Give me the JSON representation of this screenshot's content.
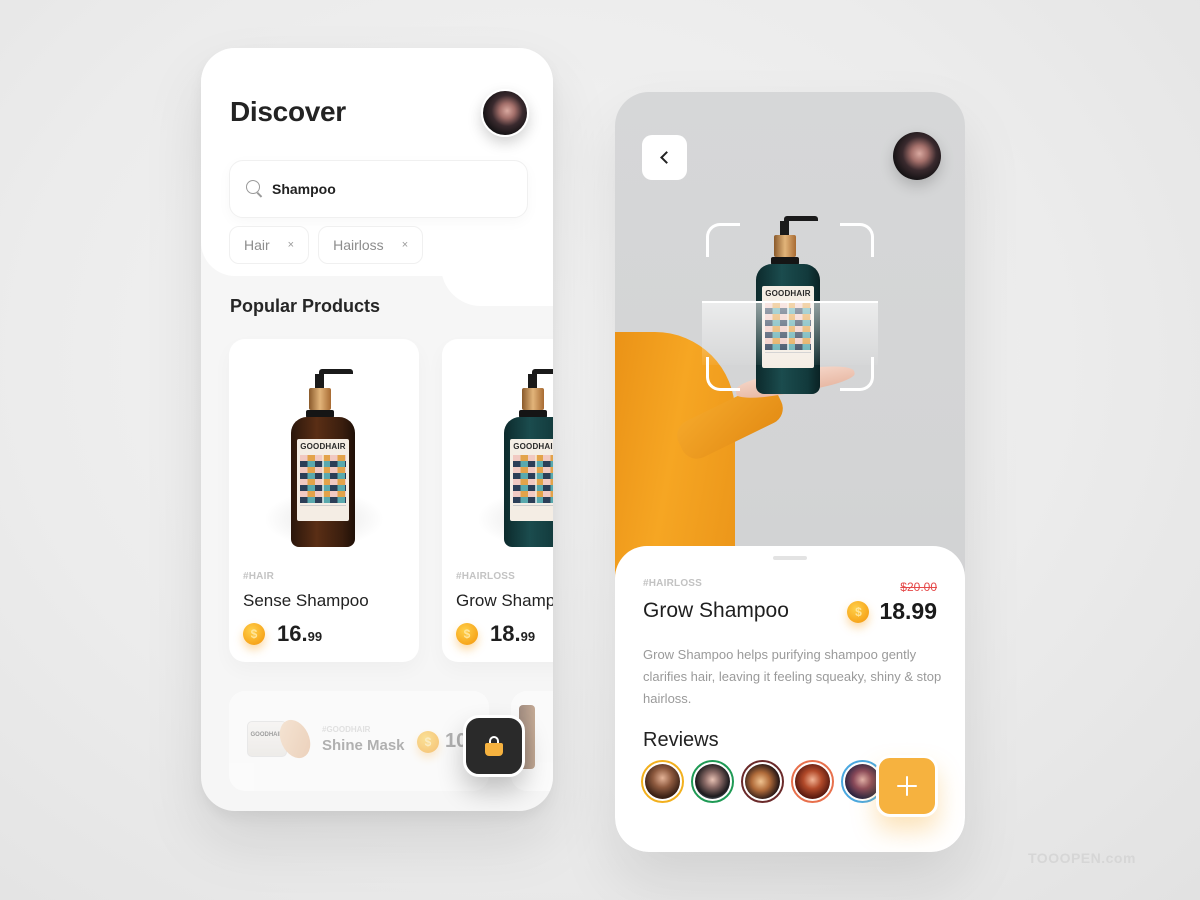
{
  "discover": {
    "title": "Discover",
    "search": {
      "value": "Shampoo",
      "placeholder": "Search"
    },
    "chips": [
      {
        "label": "Hair",
        "remove": "×"
      },
      {
        "label": "Hairloss",
        "remove": "×"
      }
    ],
    "section_title": "Popular Products",
    "products": [
      {
        "tag": "#HAIR",
        "name": "Sense Shampoo",
        "price_main": "16.",
        "price_cents": "99",
        "brand": "GOODHAIR",
        "bottle_color": "brown"
      },
      {
        "tag": "#HAIRLOSS",
        "name": "Grow Shampoo",
        "price_main": "18.",
        "price_cents": "99",
        "brand": "GOODHAIR",
        "bottle_color": "teal"
      }
    ],
    "secondary_product": {
      "tag": "#GOODHAIR",
      "name": "Shine Mask",
      "price_partial": "10",
      "brand": "GOODHAIR"
    },
    "cart_button": {
      "icon": "shopping-bag-icon"
    }
  },
  "detail": {
    "back_icon": "chevron-left-icon",
    "bottle_brand": "GOODHAIR",
    "tag": "#HAIRLOSS",
    "name": "Grow Shampoo",
    "old_price": "$20.00",
    "price": "18.99",
    "coin_symbol": "$",
    "description": "Grow Shampoo helps purifying shampoo gently clarifies hair, leaving it feeling squeaky, shiny & stop hairloss.",
    "reviews_title": "Reviews",
    "reviewers": [
      {
        "ring_color": "#f2b01e"
      },
      {
        "ring_color": "#1f9a55"
      },
      {
        "ring_color": "#6b2a2a"
      },
      {
        "ring_color": "#e8704c"
      },
      {
        "ring_color": "#4aa8e0"
      }
    ],
    "add_button": {
      "icon": "plus-icon"
    }
  },
  "colors": {
    "accent": "#f6b23f",
    "dark": "#2a2a2a",
    "old_price": "#e54848"
  },
  "watermark": "TOOOPEN.com"
}
